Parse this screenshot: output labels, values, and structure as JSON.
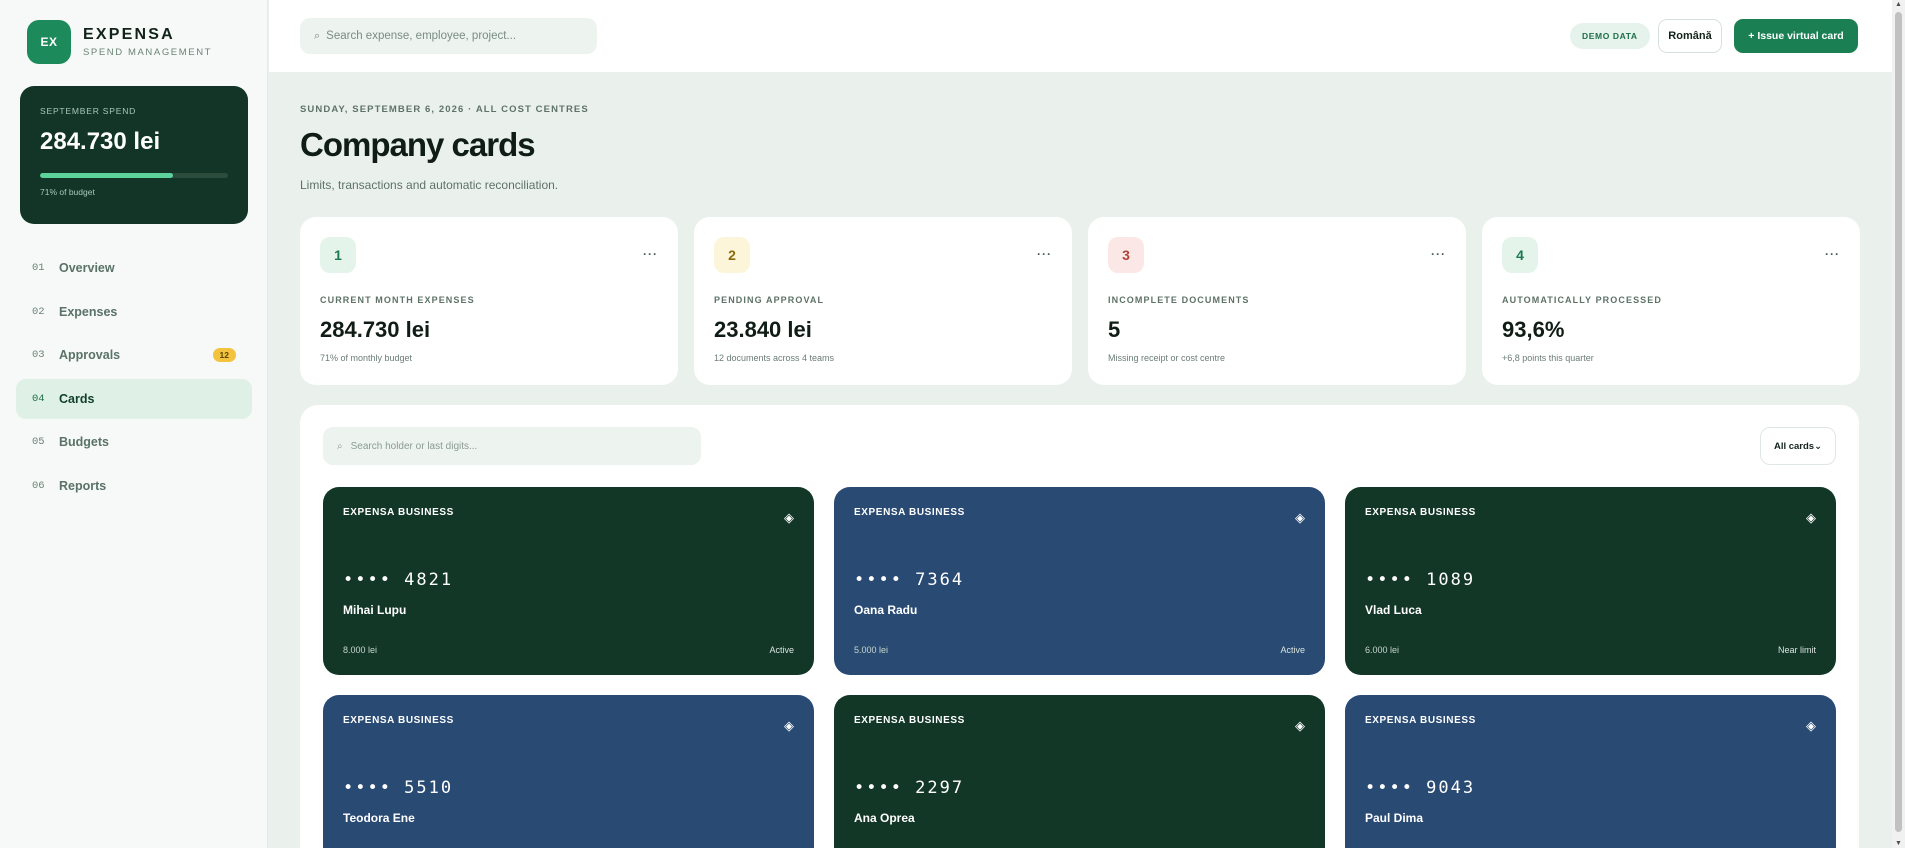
{
  "brand": {
    "logo": "EX",
    "name": "EXPENSA",
    "subtitle": "SPEND MANAGEMENT"
  },
  "spend_summary": {
    "label": "SEPTEMBER SPEND",
    "value": "284.730 lei",
    "progress_percent": 71,
    "note": "71% of budget"
  },
  "sidebar": {
    "items": [
      {
        "num": "01",
        "label": "Overview",
        "badge": ""
      },
      {
        "num": "02",
        "label": "Expenses",
        "badge": ""
      },
      {
        "num": "03",
        "label": "Approvals",
        "badge": "12"
      },
      {
        "num": "04",
        "label": "Cards",
        "badge": "",
        "active": true
      },
      {
        "num": "05",
        "label": "Budgets",
        "badge": ""
      },
      {
        "num": "06",
        "label": "Reports",
        "badge": ""
      }
    ]
  },
  "topbar": {
    "search_icon": "⌕",
    "search_placeholder": "Search expense, employee, project...",
    "demo_badge": "DEMO DATA",
    "language_button": "Română",
    "issue_button": "+ Issue virtual card"
  },
  "header": {
    "dateline": "SUNDAY, SEPTEMBER 6, 2026 · ALL COST CENTRES",
    "title": "Company cards",
    "subtitle": "Limits, transactions and automatic reconciliation."
  },
  "stats": [
    {
      "num": "1",
      "label": "CURRENT MONTH EXPENSES",
      "value": "284.730 lei",
      "note": "71% of monthly budget",
      "bg": "#e4f4ea",
      "fg": "#1d7a4f"
    },
    {
      "num": "2",
      "label": "PENDING APPROVAL",
      "value": "23.840 lei",
      "note": "12 documents across 4 teams",
      "bg": "#fdf5d9",
      "fg": "#8a6a0e"
    },
    {
      "num": "3",
      "label": "INCOMPLETE DOCUMENTS",
      "value": "5",
      "note": "Missing receipt or cost centre",
      "bg": "#fbe8e6",
      "fg": "#b0433a"
    },
    {
      "num": "4",
      "label": "AUTOMATICALLY PROCESSED",
      "value": "93,6%",
      "note": "+6,8 points this quarter",
      "bg": "#e4f4ea",
      "fg": "#1d7a4f"
    }
  ],
  "stat_more_icon": "···",
  "cards_panel": {
    "search_icon": "⌕",
    "search_placeholder": "Search holder or last digits...",
    "filter_label": "All cards⌄"
  },
  "cards": [
    {
      "brand": "EXPENSA BUSINESS",
      "chip_icon": "◈",
      "number": "•••• 4821",
      "holder": "Mihai Lupu",
      "limit": "8.000 lei",
      "status": "Active",
      "color": "green"
    },
    {
      "brand": "EXPENSA BUSINESS",
      "chip_icon": "◈",
      "number": "•••• 7364",
      "holder": "Oana Radu",
      "limit": "5.000 lei",
      "status": "Active",
      "color": "blue"
    },
    {
      "brand": "EXPENSA BUSINESS",
      "chip_icon": "◈",
      "number": "•••• 1089",
      "holder": "Vlad Luca",
      "limit": "6.000 lei",
      "status": "Near limit",
      "color": "green"
    },
    {
      "brand": "EXPENSA BUSINESS",
      "chip_icon": "◈",
      "number": "•••• 5510",
      "holder": "Teodora Ene",
      "limit": "",
      "status": "",
      "color": "blue"
    },
    {
      "brand": "EXPENSA BUSINESS",
      "chip_icon": "◈",
      "number": "•••• 2297",
      "holder": "Ana Oprea",
      "limit": "",
      "status": "",
      "color": "green"
    },
    {
      "brand": "EXPENSA BUSINESS",
      "chip_icon": "◈",
      "number": "•••• 9043",
      "holder": "Paul Dima",
      "limit": "",
      "status": "",
      "color": "blue"
    }
  ],
  "colors": {
    "accent": "#1a7f53",
    "sidebar_dark": "#133527",
    "card_green": "#133727",
    "card_blue": "#294a72"
  }
}
